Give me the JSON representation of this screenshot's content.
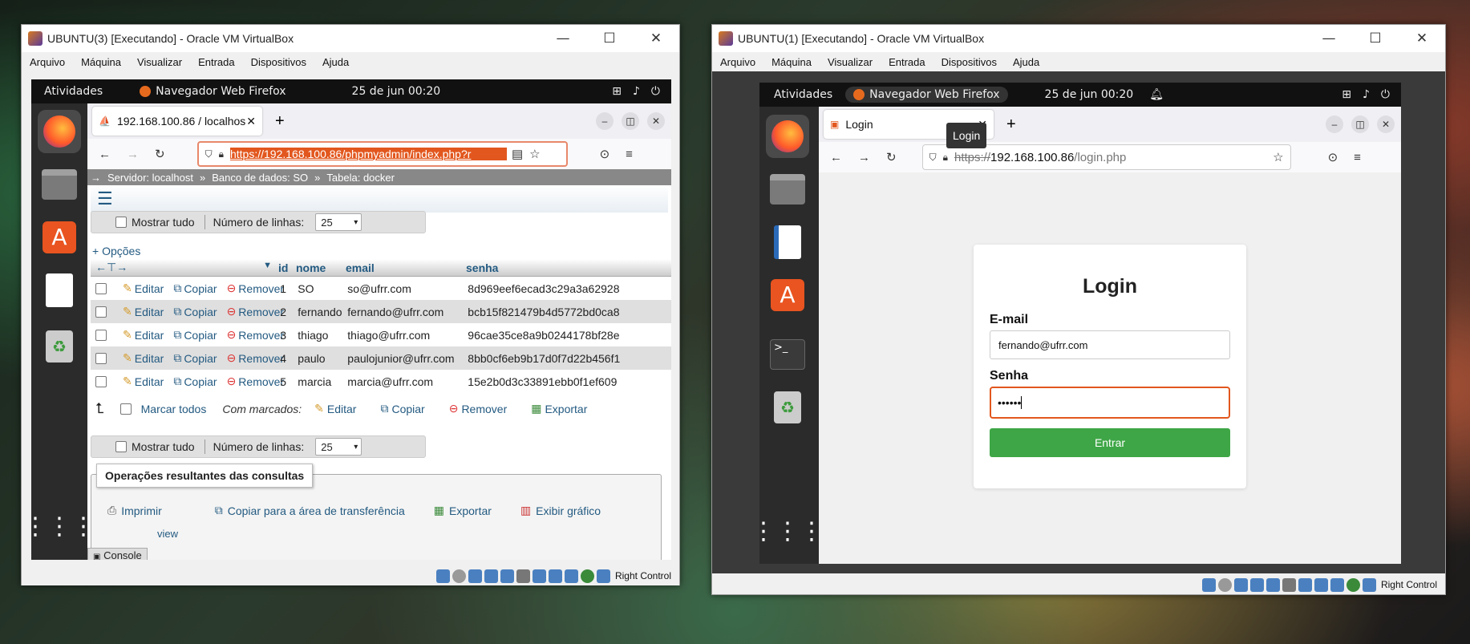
{
  "left_vm": {
    "title": "UBUNTU(3) [Executando] - Oracle VM VirtualBox",
    "menu": [
      "Arquivo",
      "Máquina",
      "Visualizar",
      "Entrada",
      "Dispositivos",
      "Ajuda"
    ],
    "topbar": {
      "activities": "Atividades",
      "app": "Navegador Web Firefox",
      "clock": "25 de jun  00:20"
    },
    "tab_title": "192.168.100.86 / localhos",
    "url": "https://192.168.100.86/phpmyadmin/index.php?r",
    "breadcrumb": [
      "Servidor: localhost",
      "Banco de dados: SO",
      "Tabela: docker"
    ],
    "show_all": "Mostrar tudo",
    "rows_label": "Número de linhas:",
    "rows_value": "25",
    "options": "+ Opções",
    "columns": [
      "id",
      "nome",
      "email",
      "senha"
    ],
    "actions": {
      "edit": "Editar",
      "copy": "Copiar",
      "remove": "Remover"
    },
    "records": [
      {
        "id": "1",
        "nome": "SO",
        "email": "so@ufrr.com",
        "senha": "8d969eef6ecad3c29a3a62928"
      },
      {
        "id": "2",
        "nome": "fernando",
        "email": "fernando@ufrr.com",
        "senha": "bcb15f821479b4d5772bd0ca8"
      },
      {
        "id": "3",
        "nome": "thiago",
        "email": "thiago@ufrr.com",
        "senha": "96cae35ce8a9b0244178bf28e"
      },
      {
        "id": "4",
        "nome": "paulo",
        "email": "paulojunior@ufrr.com",
        "senha": "8bb0cf6eb9b17d0f7d22b456f1"
      },
      {
        "id": "5",
        "nome": "marcia",
        "email": "marcia@ufrr.com",
        "senha": "15e2b0d3c33891ebb0f1ef609"
      }
    ],
    "bulk": {
      "mark_all": "Marcar todos",
      "with_marked": "Com marcados:",
      "edit": "Editar",
      "copy": "Copiar",
      "remove": "Remover",
      "export": "Exportar"
    },
    "ops_title": "Operações resultantes das consultas",
    "ops": {
      "print": "Imprimir",
      "copy_clip": "Copiar para a área de transferência",
      "export": "Exportar",
      "chart": "Exibir gráfico"
    },
    "console": "Console",
    "view": "view",
    "host_key": "Right Control"
  },
  "right_vm": {
    "title": "UBUNTU(1) [Executando] - Oracle VM VirtualBox",
    "menu": [
      "Arquivo",
      "Máquina",
      "Visualizar",
      "Entrada",
      "Dispositivos",
      "Ajuda"
    ],
    "topbar": {
      "activities": "Atividades",
      "app": "Navegador Web Firefox",
      "clock": "25 de jun  00:20"
    },
    "tab_title": "Login",
    "tooltip": "Login",
    "url_prefix": "https://",
    "url_host": "192.168.100.86",
    "url_path": "/login.php",
    "login": {
      "heading": "Login",
      "email_label": "E-mail",
      "email_value": "fernando@ufrr.com",
      "password_label": "Senha",
      "password_value": "••••••",
      "submit": "Entrar"
    },
    "host_key": "Right Control"
  },
  "colors": {
    "accent_green": "#3ea646",
    "pma_link": "#235a81",
    "focus_orange": "#e2571e"
  }
}
